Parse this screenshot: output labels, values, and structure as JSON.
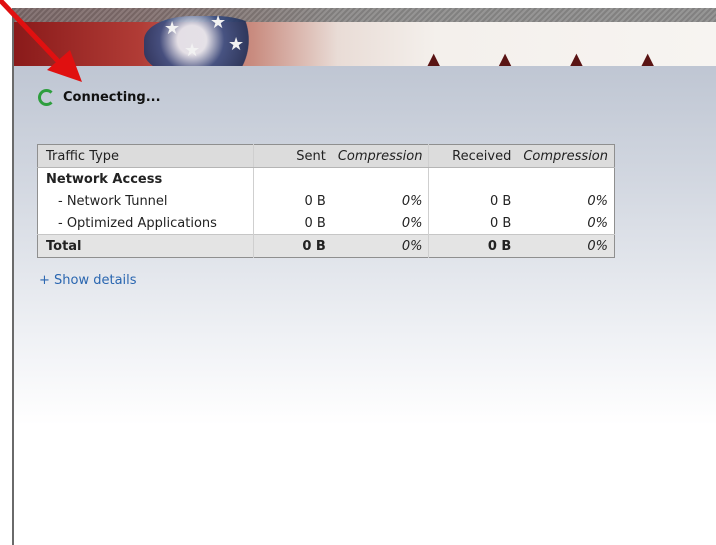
{
  "status": {
    "text": "Connecting..."
  },
  "table": {
    "headers": {
      "traffic_type": "Traffic Type",
      "sent": "Sent",
      "sent_compression": "Compression",
      "received": "Received",
      "received_compression": "Compression"
    },
    "group_label": "Network Access",
    "rows": [
      {
        "type": "- Network Tunnel",
        "sent": "0 B",
        "sent_comp": "0%",
        "received": "0 B",
        "received_comp": "0%"
      },
      {
        "type": "- Optimized Applications",
        "sent": "0 B",
        "sent_comp": "0%",
        "received": "0 B",
        "received_comp": "0%"
      }
    ],
    "total": {
      "type": "Total",
      "sent": "0 B",
      "sent_comp": "0%",
      "received": "0 B",
      "received_comp": "0%"
    }
  },
  "links": {
    "show_details": "+ Show details"
  },
  "colors": {
    "spinner": "#2e9e3e",
    "link": "#2a66b0",
    "annotation_arrow": "#e01010"
  }
}
